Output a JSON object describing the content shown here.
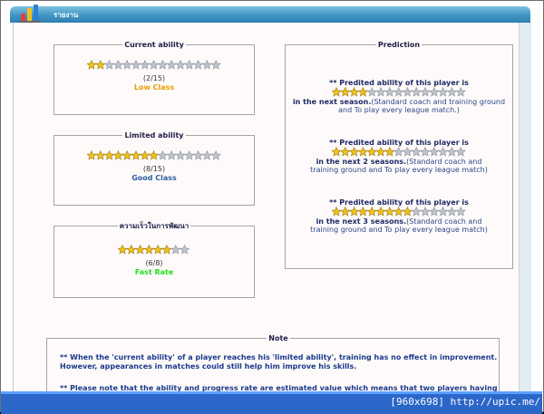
{
  "window": {
    "title": "รายงาน"
  },
  "current_ability": {
    "legend": "Current ability",
    "value": 2,
    "max": 15,
    "fraction": "(2/15)",
    "class_label": "Low Class"
  },
  "limited_ability": {
    "legend": "Limited ability",
    "value": 8,
    "max": 15,
    "fraction": "(8/15)",
    "class_label": "Good Class"
  },
  "progress_rate": {
    "legend": "ความเร็วในการพัฒนา",
    "value": 6,
    "max": 8,
    "fraction": "(6/8)",
    "class_label": "Fast Rate"
  },
  "prediction": {
    "legend": "Prediction",
    "items": [
      {
        "head": "** Predited ability of this player is",
        "stars": 4,
        "max": 15,
        "period": "in the next season.",
        "note": "(Standard coach and training ground and To play every league match.)"
      },
      {
        "head": "** Predited ability of this player is",
        "stars": 7,
        "max": 15,
        "period": "in the next 2 seasons.",
        "note": "(Standard coach and training ground and To play every league match)"
      },
      {
        "head": "** Predited ability of this player is",
        "stars": 9,
        "max": 15,
        "period": "in the next 3 seasons.",
        "note": "(Standard coach and training ground and To play every league match)"
      }
    ]
  },
  "note": {
    "legend": "Note",
    "line1": "** When the 'current ability' of a player reaches his 'limited ability', training has no effect in improvement.",
    "line2": "However, appearances in matches could still help him improve his skills.",
    "line3": "** Please note that the ability and progress rate are estimated value which means that two players having"
  },
  "caption": "[960x698] http://upic.me/",
  "colors": {
    "star_filled": "#f2c21b",
    "star_empty": "#bfc5cc",
    "title_bar": "#3f95c4",
    "taskbar": "#2b66c9"
  }
}
